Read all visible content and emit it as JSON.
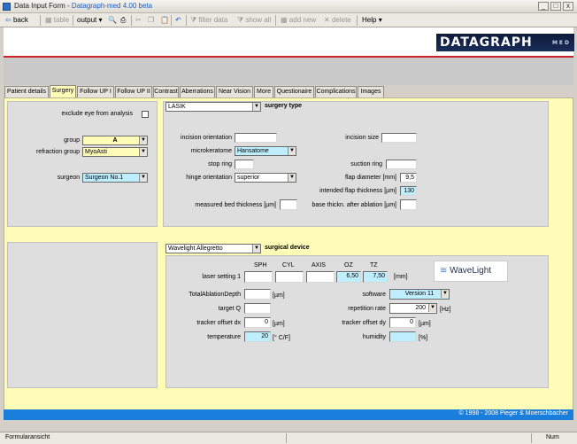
{
  "window": {
    "title_prefix": "Data Input Form - ",
    "title_app": "Datagraph-med 4.00 beta",
    "min": "_",
    "max": "□",
    "close": "x"
  },
  "toolbar": {
    "back": "back",
    "table": "table",
    "output": "output",
    "filter": "filter data",
    "show_all": "show all",
    "add_new": "add new",
    "delete": "delete",
    "help": "Help"
  },
  "logo": {
    "text": "DATAGRAPH",
    "sub": "MED"
  },
  "tabs": [
    "Patient details",
    "Surgery",
    "Follow UP I",
    "Follow UP II",
    "Contrast",
    "Aberrations",
    "Near Vision",
    "More",
    "Questionaire",
    "Complications",
    "Images"
  ],
  "surgery": {
    "exclude_label": "exclude eye from analysis",
    "group_label": "group",
    "group_value": "A",
    "refraction_group_label": "refraction group",
    "refraction_group_value": "MyoAsti",
    "surgeon_label": "surgeon",
    "surgeon_value": "Surgeon No.1",
    "surgery_type_value": "LASIK",
    "surgery_type_label": "surgery type",
    "incision_orientation": "incision orientation",
    "incision_size": "incision size",
    "microkeratome_label": "microkeratome",
    "microkeratome_value": "Hansatome",
    "stop_ring": "stop ring",
    "suction_ring": "suction ring",
    "hinge_orientation_label": "hinge orientation",
    "hinge_orientation_value": "superior",
    "flap_diameter_label": "flap diameter [mm]",
    "flap_diameter_value": "9,5",
    "intended_flap_label": "intended flap thickness [µm]",
    "intended_flap_value": "130",
    "measured_bed_label": "measured bed thickness [µm]",
    "base_thickn_label": "base thickn. after ablation [µm]"
  },
  "device": {
    "device_value": "Wavelight Allegretto",
    "device_label": "surgical device",
    "col_sph": "SPH",
    "col_cyl": "CYL",
    "col_axis": "AXIS",
    "col_oz": "OZ",
    "col_tz": "TZ",
    "laser_setting_label": "laser setting 1",
    "oz_value": "6,50",
    "tz_value": "7,50",
    "mm_unit": "[mm]",
    "total_ablation_label": "TotalAblationDepth",
    "um_unit1": "[µm]",
    "target_q_label": "target Q",
    "tracker_dx_label": "tracker offset dx",
    "tracker_dx_value": "0",
    "um_unit2": "[µm]",
    "temperature_label": "temperature",
    "temperature_value": "20",
    "temp_unit": "[° C/F]",
    "software_label": "software",
    "software_value": "Version 11",
    "repetition_label": "repetition rate",
    "repetition_value": "200",
    "hz_unit": "[Hz]",
    "tracker_dy_label": "tracker offset dy",
    "tracker_dy_value": "0",
    "um_unit3": "[µm]",
    "humidity_label": "humidity",
    "pct_unit": "[%]",
    "wavelight_logo": "WaveLight"
  },
  "footer": {
    "copyright": "© 1998 - 2008 Pieger & Moerschbacher"
  },
  "status": {
    "left": "Formularansicht",
    "right": "Num"
  }
}
